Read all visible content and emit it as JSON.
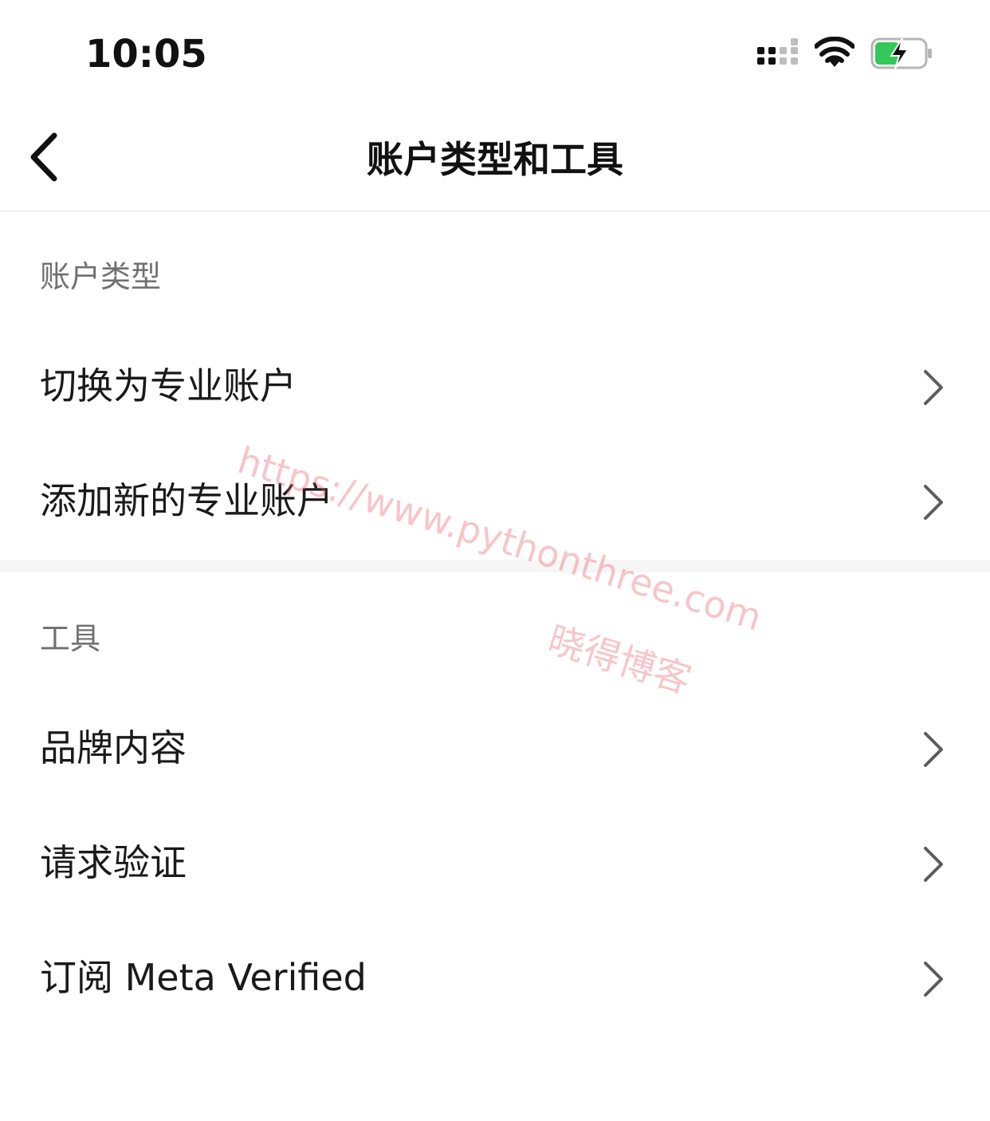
{
  "status_bar": {
    "time": "10:05",
    "icons": [
      "signal-icon",
      "wifi-icon",
      "battery-charging-icon"
    ],
    "battery_color": "#34c759"
  },
  "nav": {
    "title": "账户类型和工具",
    "back_icon": "chevron-left-icon"
  },
  "sections": {
    "account_type": {
      "header": "账户类型",
      "items": [
        {
          "label": "切换为专业账户"
        },
        {
          "label": "添加新的专业账户"
        }
      ]
    },
    "tools": {
      "header": "工具",
      "items": [
        {
          "label": "品牌内容"
        },
        {
          "label": "请求验证"
        },
        {
          "label": "订阅 Meta Verified"
        }
      ]
    }
  },
  "watermark": {
    "url": "https://www.pythonthree.com",
    "name": "晓得博客"
  },
  "colors": {
    "text_primary": "#1a1a1a",
    "text_secondary": "#707070",
    "chevron": "#5c5c5c",
    "divider": "#f6f6f6",
    "watermark": "#e85a64"
  }
}
